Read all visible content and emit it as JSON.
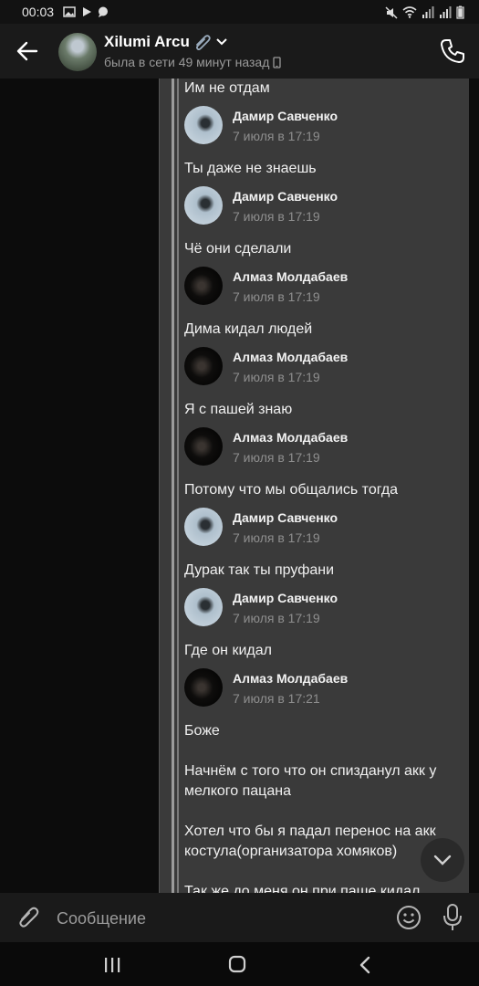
{
  "status_bar": {
    "time": "00:03"
  },
  "header": {
    "title": "Xilumi Arcu",
    "status": "была в сети 49 минут назад"
  },
  "messages": [
    {
      "type": "text",
      "text": "Им не отдам"
    },
    {
      "type": "author",
      "avatar": "damir",
      "name": "Дамир Савченко",
      "date": "7 июля в 17:19"
    },
    {
      "type": "text",
      "text": "Ты даже не знаешь"
    },
    {
      "type": "author",
      "avatar": "damir",
      "name": "Дамир Савченко",
      "date": "7 июля в 17:19"
    },
    {
      "type": "text",
      "text": "Чё они сделали"
    },
    {
      "type": "author",
      "avatar": "almaz",
      "name": "Алмаз Молдабаев",
      "date": "7 июля в 17:19"
    },
    {
      "type": "text",
      "text": "Дима кидал людей"
    },
    {
      "type": "author",
      "avatar": "almaz",
      "name": "Алмаз Молдабаев",
      "date": "7 июля в 17:19"
    },
    {
      "type": "text",
      "text": "Я с пашей знаю"
    },
    {
      "type": "author",
      "avatar": "almaz",
      "name": "Алмаз Молдабаев",
      "date": "7 июля в 17:19"
    },
    {
      "type": "text",
      "text": "Потому что мы общались тогда"
    },
    {
      "type": "author",
      "avatar": "damir",
      "name": "Дамир Савченко",
      "date": "7 июля в 17:19"
    },
    {
      "type": "text",
      "text": "Дурак так ты пруфани"
    },
    {
      "type": "author",
      "avatar": "damir",
      "name": "Дамир Савченко",
      "date": "7 июля в 17:19"
    },
    {
      "type": "text",
      "text": "Где он кидал"
    },
    {
      "type": "author",
      "avatar": "almaz",
      "name": "Алмаз Молдабаев",
      "date": "7 июля в 17:21"
    },
    {
      "type": "text",
      "text": "Боже"
    },
    {
      "type": "text",
      "text": "Начнём с того что он спизданул акк у мелкого пацана",
      "gap": true
    },
    {
      "type": "text",
      "text": "Хотел что бы я падал перенос на акк костула(организатора хомяков)",
      "gap": true
    },
    {
      "type": "text",
      "text": "Так же до меня он при паше кидал людей",
      "gap": true
    },
    {
      "type": "author",
      "avatar": "damir",
      "name": "Дамир Савченко",
      "date": ""
    }
  ],
  "input": {
    "placeholder": "Сообщение"
  },
  "icons": {
    "back": "arrow-left-icon",
    "phone": "phone-icon",
    "attach": "paperclip-icon",
    "emoji": "smile-icon",
    "mic": "microphone-icon",
    "scroll": "chevron-down-icon"
  },
  "colors": {
    "background": "#0c0c0c",
    "card": "#3a3a3a",
    "header": "#1a1a1a"
  }
}
